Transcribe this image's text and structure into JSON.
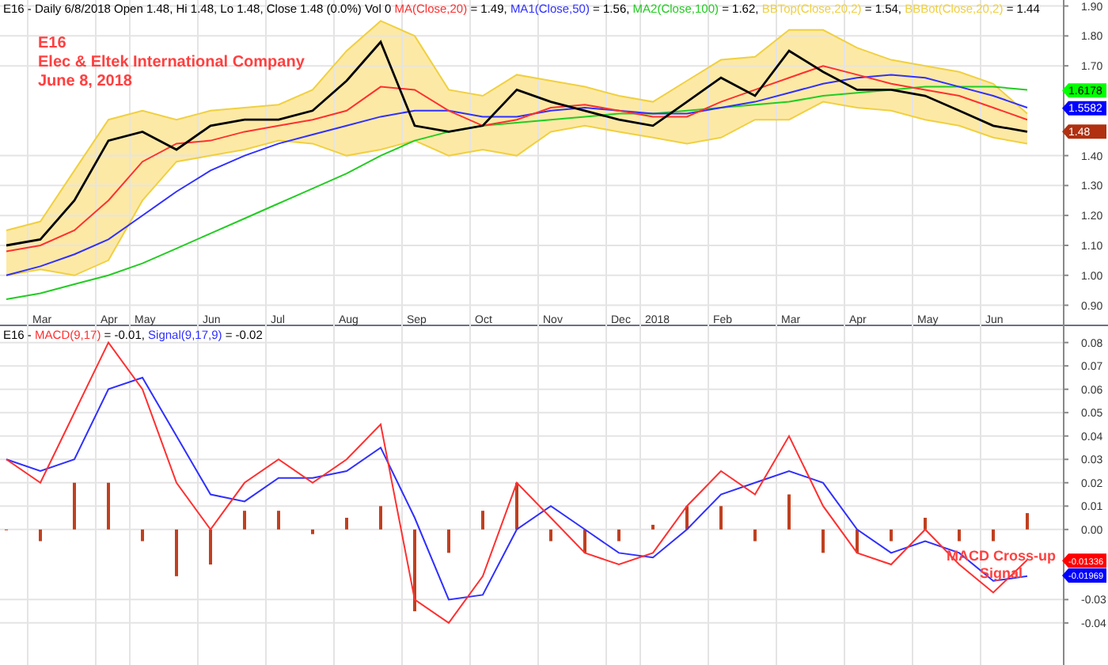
{
  "price_pane": {
    "legend": {
      "prefix": "E16 - Daily 6/8/2018 Open 1.48, Hi 1.48, Lo 1.48, Close 1.48 (0.0%) Vol 0",
      "values": [
        "= 1.49,",
        "= 1.56,",
        "= 1.62,",
        "= 1.54,",
        "= 1.44"
      ]
    },
    "annotation": [
      "E16",
      "Elec & Eltek International Company",
      "June 8, 2018"
    ],
    "value_badges": [
      {
        "text": "1.6178",
        "color": "#00ff00"
      },
      {
        "text": "1.5582",
        "color": "#0000ff"
      },
      {
        "text": "1.48",
        "color": "#b03010"
      }
    ],
    "chart_data": {
      "type": "line",
      "grid": true,
      "ylim": [
        0.83,
        1.92
      ],
      "categories": [
        null,
        "Mar",
        null,
        "Apr",
        "May",
        null,
        "Jun",
        null,
        "Jul",
        null,
        "Aug",
        null,
        "Sep",
        null,
        "Oct",
        null,
        "Nov",
        null,
        "Dec",
        "2018",
        null,
        "Feb",
        null,
        "Mar",
        null,
        "Apr",
        null,
        "May",
        null,
        "Jun",
        null
      ],
      "yticks": [
        {
          "value": 0.9,
          "label": "0.90"
        },
        {
          "value": 1.0,
          "label": "1.00"
        },
        {
          "value": 1.1,
          "label": "1.10"
        },
        {
          "value": 1.2,
          "label": "1.20"
        },
        {
          "value": 1.3,
          "label": "1.30"
        },
        {
          "value": 1.4,
          "label": "1.40"
        },
        {
          "value": 1.7,
          "label": "1.70"
        },
        {
          "value": 1.8,
          "label": "1.80"
        },
        {
          "value": 1.9,
          "label": "1.90"
        }
      ],
      "series": [
        {
          "color": "#000000",
          "values": [
            1.1,
            1.12,
            1.25,
            1.45,
            1.48,
            1.42,
            1.5,
            1.52,
            1.52,
            1.55,
            1.65,
            1.78,
            1.5,
            1.48,
            1.5,
            1.62,
            1.58,
            1.55,
            1.52,
            1.5,
            1.58,
            1.66,
            1.6,
            1.75,
            1.68,
            1.62,
            1.62,
            1.6,
            1.55,
            1.5,
            1.48
          ]
        },
        {
          "name": "MA(Close,20)",
          "color": "#ff3030",
          "values": [
            1.08,
            1.1,
            1.15,
            1.25,
            1.38,
            1.44,
            1.45,
            1.48,
            1.5,
            1.52,
            1.55,
            1.63,
            1.62,
            1.55,
            1.5,
            1.52,
            1.56,
            1.57,
            1.55,
            1.53,
            1.53,
            1.58,
            1.62,
            1.66,
            1.7,
            1.67,
            1.64,
            1.62,
            1.6,
            1.56,
            1.52
          ]
        },
        {
          "name": "MA1(Close,50)",
          "color": "#3030ff",
          "values": [
            1.0,
            1.03,
            1.07,
            1.12,
            1.2,
            1.28,
            1.35,
            1.4,
            1.44,
            1.47,
            1.5,
            1.53,
            1.55,
            1.55,
            1.53,
            1.53,
            1.55,
            1.56,
            1.55,
            1.54,
            1.54,
            1.56,
            1.58,
            1.61,
            1.64,
            1.66,
            1.67,
            1.66,
            1.63,
            1.6,
            1.56
          ]
        },
        {
          "name": "MA2(Close,100)",
          "color": "#22cc22",
          "values": [
            0.92,
            0.94,
            0.97,
            1.0,
            1.04,
            1.09,
            1.14,
            1.19,
            1.24,
            1.29,
            1.34,
            1.4,
            1.45,
            1.48,
            1.5,
            1.51,
            1.52,
            1.53,
            1.54,
            1.54,
            1.55,
            1.56,
            1.57,
            1.58,
            1.6,
            1.61,
            1.62,
            1.63,
            1.63,
            1.63,
            1.62
          ]
        },
        {
          "name": "BBTop(Close,20,2)",
          "color": "#f0d040",
          "values": [
            1.15,
            1.18,
            1.35,
            1.52,
            1.55,
            1.52,
            1.55,
            1.56,
            1.57,
            1.62,
            1.75,
            1.85,
            1.8,
            1.62,
            1.6,
            1.67,
            1.65,
            1.63,
            1.6,
            1.58,
            1.65,
            1.72,
            1.73,
            1.82,
            1.82,
            1.76,
            1.72,
            1.7,
            1.68,
            1.64,
            1.54
          ]
        },
        {
          "name": "BBBot(Close,20,2)",
          "color": "#f0d040",
          "values": [
            1.0,
            1.02,
            1.0,
            1.05,
            1.25,
            1.38,
            1.4,
            1.42,
            1.45,
            1.44,
            1.4,
            1.42,
            1.45,
            1.4,
            1.42,
            1.4,
            1.48,
            1.5,
            1.48,
            1.46,
            1.44,
            1.46,
            1.52,
            1.52,
            1.58,
            1.56,
            1.55,
            1.52,
            1.5,
            1.46,
            1.44
          ]
        }
      ]
    }
  },
  "macd_pane": {
    "legend": {
      "prefix": "E16 -",
      "values": [
        "= -0.01,",
        "= -0.02"
      ]
    },
    "annotation": [
      "MACD Cross-up",
      "Signal"
    ],
    "value_badges": [
      {
        "text": "-0.01336",
        "color": "#ff0000"
      },
      {
        "text": "-0.01969",
        "color": "#0000ff"
      }
    ],
    "chart_data": {
      "type": "line",
      "grid": true,
      "ylim": [
        -0.058,
        0.087
      ],
      "yticks": [
        {
          "value": -0.04,
          "label": "-0.04"
        },
        {
          "value": -0.03,
          "label": "-0.03"
        },
        {
          "value": 0.0,
          "label": "0.00"
        },
        {
          "value": 0.01,
          "label": "0.01"
        },
        {
          "value": 0.02,
          "label": "0.02"
        },
        {
          "value": 0.03,
          "label": "0.03"
        },
        {
          "value": 0.04,
          "label": "0.04"
        },
        {
          "value": 0.05,
          "label": "0.05"
        },
        {
          "value": 0.06,
          "label": "0.06"
        },
        {
          "value": 0.07,
          "label": "0.07"
        },
        {
          "value": 0.08,
          "label": "0.08"
        }
      ],
      "series": [
        {
          "name": "MACD(9,17)",
          "color": "#ff3030",
          "values": [
            0.03,
            0.02,
            0.05,
            0.08,
            0.06,
            0.02,
            0.0,
            0.02,
            0.03,
            0.02,
            0.03,
            0.045,
            -0.03,
            -0.04,
            -0.02,
            0.02,
            0.005,
            -0.01,
            -0.015,
            -0.01,
            0.01,
            0.025,
            0.015,
            0.04,
            0.01,
            -0.01,
            -0.015,
            0.0,
            -0.015,
            -0.027,
            -0.013
          ]
        },
        {
          "name": "Signal(9,17,9)",
          "color": "#3030ff",
          "values": [
            0.03,
            0.025,
            0.03,
            0.06,
            0.065,
            0.04,
            0.015,
            0.012,
            0.022,
            0.022,
            0.025,
            0.035,
            0.005,
            -0.03,
            -0.028,
            0.0,
            0.01,
            0.0,
            -0.01,
            -0.012,
            0.0,
            0.015,
            0.02,
            0.025,
            0.02,
            0.0,
            -0.01,
            -0.005,
            -0.01,
            -0.022,
            -0.02
          ]
        },
        {
          "type": "bar",
          "color": "#c04020",
          "values": [
            0.0,
            -0.005,
            0.02,
            0.02,
            -0.005,
            -0.02,
            -0.015,
            0.008,
            0.008,
            -0.002,
            0.005,
            0.01,
            -0.035,
            -0.01,
            0.008,
            0.02,
            -0.005,
            -0.01,
            -0.005,
            0.002,
            0.01,
            0.01,
            -0.005,
            0.015,
            -0.01,
            -0.01,
            -0.005,
            0.005,
            -0.005,
            -0.005,
            0.007
          ]
        }
      ]
    }
  }
}
